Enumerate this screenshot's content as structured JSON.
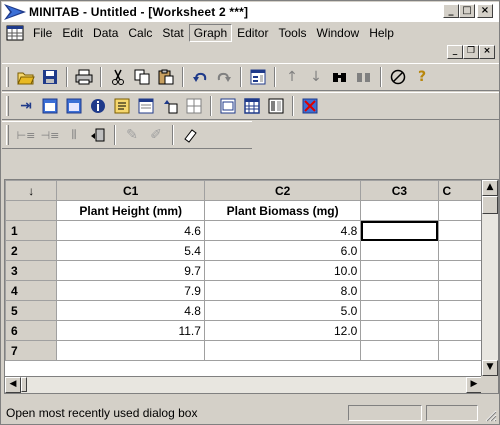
{
  "window": {
    "title": "MINITAB - Untitled - [Worksheet 2 ***]",
    "controls": {
      "minimize": "_",
      "maximize": "□",
      "close": "×"
    }
  },
  "menu": {
    "items": [
      {
        "label": "File",
        "key": "F"
      },
      {
        "label": "Edit",
        "key": "E"
      },
      {
        "label": "Data",
        "key": "a"
      },
      {
        "label": "Calc",
        "key": "C"
      },
      {
        "label": "Stat",
        "key": "S"
      },
      {
        "label": "Graph",
        "key": "G"
      },
      {
        "label": "Editor",
        "key": "i"
      },
      {
        "label": "Tools",
        "key": "T"
      },
      {
        "label": "Window",
        "key": "W"
      },
      {
        "label": "Help",
        "key": "H"
      }
    ],
    "mdi_controls": {
      "minimize": "_",
      "restore": "❐",
      "close": "×"
    }
  },
  "toolbar1": [
    "open-icon",
    "save-icon",
    "print-icon",
    "cut-icon",
    "copy-icon",
    "paste-icon",
    "undo-icon",
    "redo-icon",
    "edit-last-dialog-icon",
    "up-arrow-icon",
    "down-arrow-icon",
    "find-icon",
    "replace-icon",
    "cancel-icon",
    "help-icon"
  ],
  "toolbar2": [
    "session-window-icon",
    "worksheet-window-icon",
    "graph-window-icon",
    "info-icon",
    "history-icon",
    "project-manager-icon",
    "report-pad-icon",
    "related-docs-icon",
    "layout-icon",
    "grid-view-icon",
    "columns-icon",
    "close-all-graphs-icon"
  ],
  "toolbar3": [
    "insert-cells-icon",
    "insert-rows-icon",
    "insert-columns-icon",
    "move-columns-icon",
    "brush-icon",
    "brush-off-icon",
    "eraser-icon"
  ],
  "worksheet": {
    "corner_symbol": "↓",
    "columns": [
      "C1",
      "C2",
      "C3",
      "C"
    ],
    "names": [
      "Plant Height (mm)",
      "Plant Biomass (mg)",
      "",
      ""
    ],
    "rows": [
      {
        "num": "1",
        "c1": "4.6",
        "c2": "4.8"
      },
      {
        "num": "2",
        "c1": "5.4",
        "c2": "6.0"
      },
      {
        "num": "3",
        "c1": "9.7",
        "c2": "10.0"
      },
      {
        "num": "4",
        "c1": "7.9",
        "c2": "8.0"
      },
      {
        "num": "5",
        "c1": "4.8",
        "c2": "5.0"
      },
      {
        "num": "6",
        "c1": "11.7",
        "c2": "12.0"
      },
      {
        "num": "7",
        "c1": "",
        "c2": ""
      }
    ]
  },
  "status": {
    "text": "Open most recently used dialog box"
  }
}
